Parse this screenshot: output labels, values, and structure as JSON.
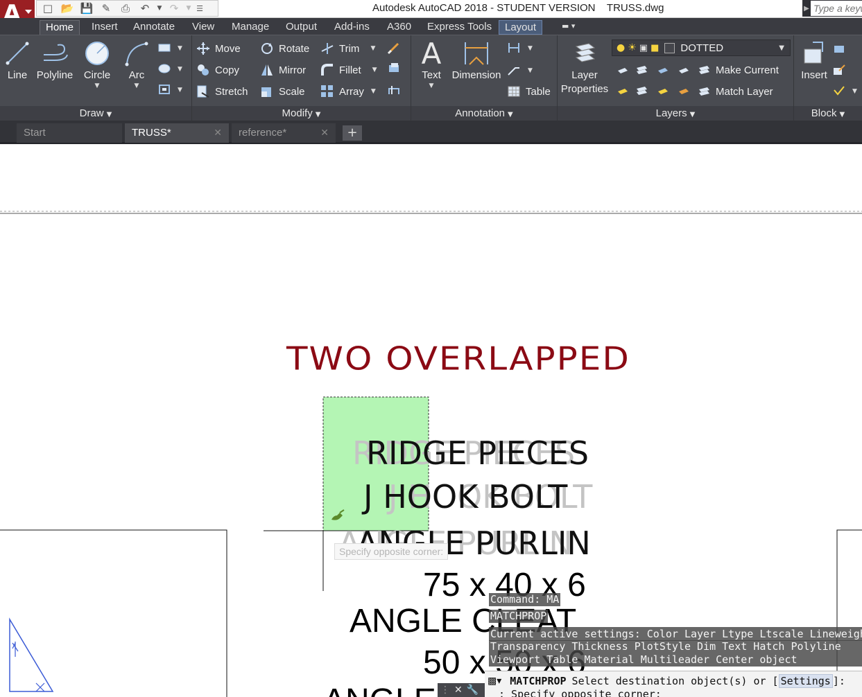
{
  "window": {
    "title": "Autodesk AutoCAD 2018 - STUDENT VERSION    TRUSS.dwg",
    "app_menu_letter": "A",
    "search_placeholder": "Type a keyword or phrase"
  },
  "ribbon_tabs": [
    "Home",
    "Insert",
    "Annotate",
    "View",
    "Manage",
    "Output",
    "Add-ins",
    "A360",
    "Express Tools",
    "Layout"
  ],
  "active_ribbon_tab": "Home",
  "draw_panel": {
    "title": "Draw",
    "line": "Line",
    "polyline": "Polyline",
    "circle": "Circle",
    "arc": "Arc"
  },
  "modify_panel": {
    "title": "Modify",
    "move": "Move",
    "copy": "Copy",
    "stretch": "Stretch",
    "rotate": "Rotate",
    "mirror": "Mirror",
    "scale": "Scale",
    "trim": "Trim",
    "fillet": "Fillet",
    "array": "Array"
  },
  "annotation_panel": {
    "title": "Annotation",
    "text": "Text",
    "dimension": "Dimension",
    "table": "Table"
  },
  "layers_panel": {
    "title": "Layers",
    "layer_properties_1": "Layer",
    "layer_properties_2": "Properties",
    "current_layer": "DOTTED",
    "make_current": "Make Current",
    "match_layer": "Match Layer"
  },
  "block_panel": {
    "title": "Block",
    "insert": "Insert"
  },
  "doc_tabs": {
    "start": "Start",
    "truss": "TRUSS*",
    "reference": "reference*",
    "new_tab": "+"
  },
  "drawing": {
    "heading": "TWO OVERLAPPED",
    "line1": "RIDGE PIECES",
    "line2": "J HOOK BOLT",
    "line3": "ANGLE PURLIN",
    "line4": "75 x 40 x 6",
    "line5": "ANGLE CLEAT",
    "line6": "50 x 50 x 6",
    "line7": "ANGLE",
    "ghost1": "RIDGE PIECES",
    "ghost2": "J HOOK BOLT",
    "ghost3": "ANGLE PURLIN",
    "tooltip": "Specify opposite corner:"
  },
  "command": {
    "history1": "Command: MA",
    "history2": "MATCHPROP",
    "history3": "Current active settings:  Color Layer Ltype Ltscale Lineweight",
    "history4": "Transparency Thickness PlotStyle Dim Text Hatch Polyline",
    "history5": "Viewport Table Material Multileader Center object",
    "prompt_cmd": "MATCHPROP",
    "prompt_text": "Select destination object(s) or [",
    "prompt_option": "Settings",
    "prompt_end": "]:",
    "prompt_line2": ": Specify opposite corner:"
  },
  "colors": {
    "heading_red": "#8b0a14",
    "selection_green": "#b4f5b4",
    "ribbon_bg": "#494b51",
    "app_red": "#9a1f23"
  }
}
